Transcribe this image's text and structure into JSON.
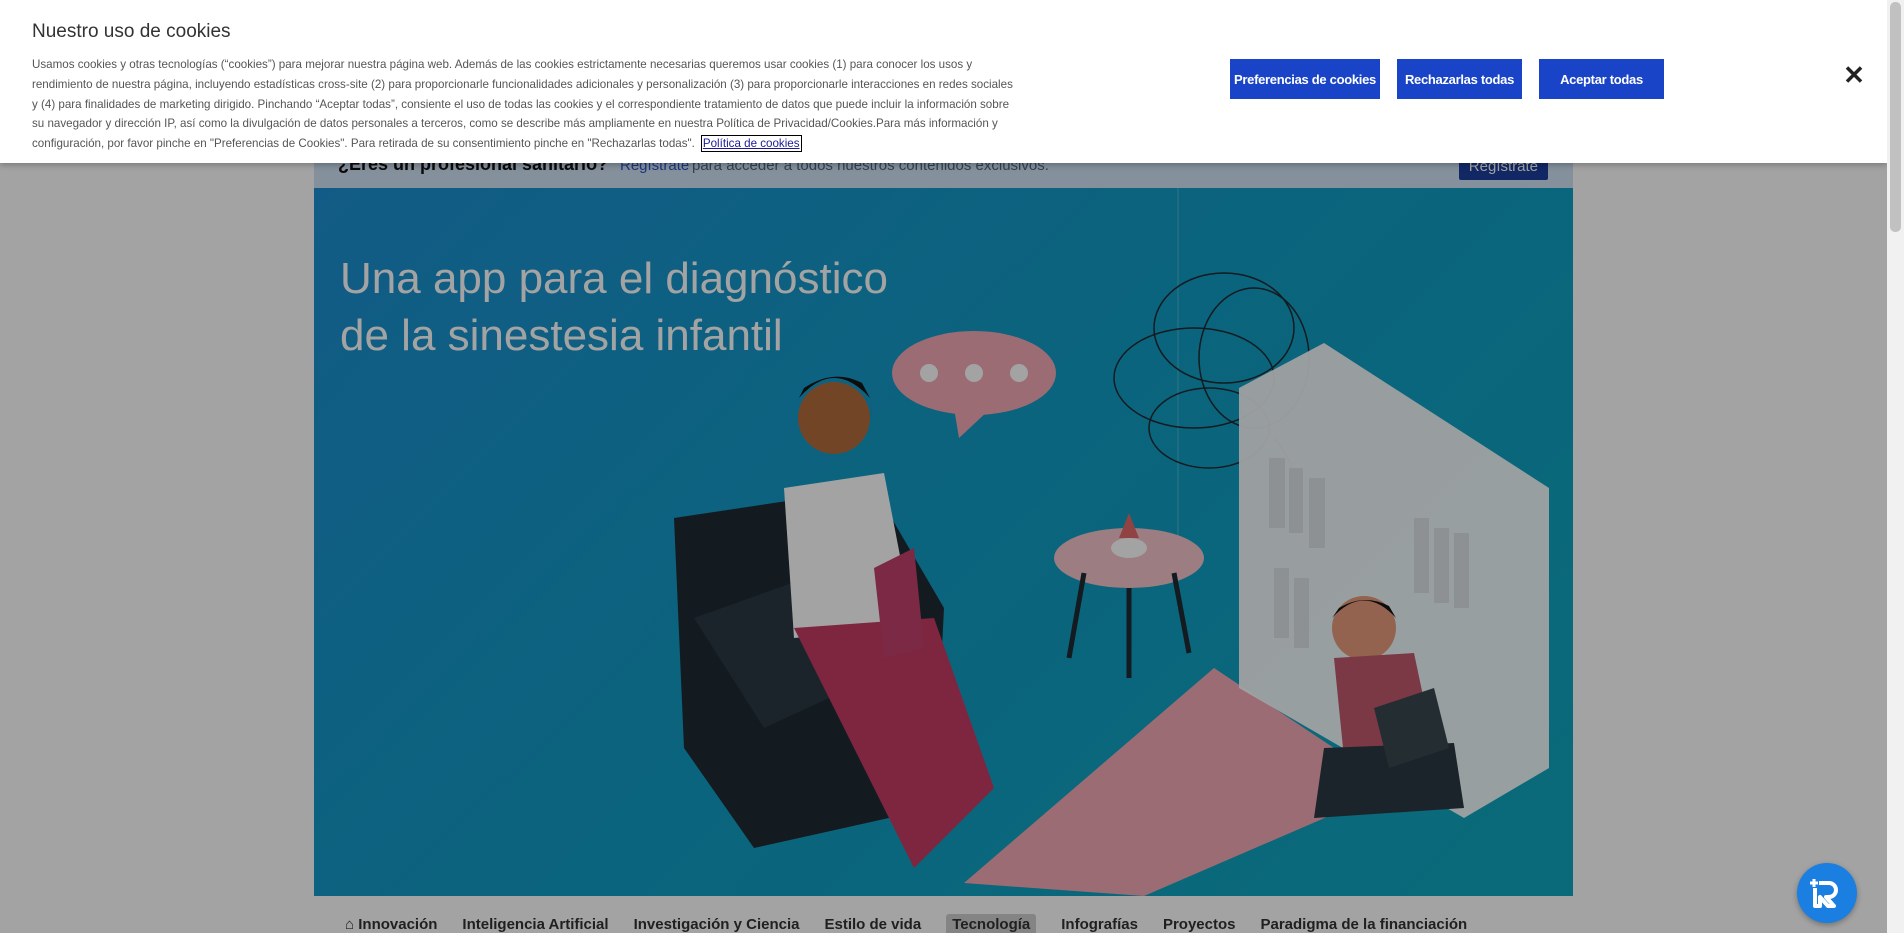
{
  "cookie_banner": {
    "title": "Nuestro uso de cookies",
    "body": "Usamos cookies y otras tecnologías (“cookies”) para mejorar nuestra página web. Además de las cookies estrictamente necesarias queremos usar cookies (1) para conocer los usos y rendimiento de nuestra página, incluyendo estadísticas cross-site (2) para proporcionarle funcionalidades adicionales y personalización (3) para proporcionarle interacciones en redes sociales y (4) para finalidades de marketing dirigido. Pinchando “Aceptar todas”, consiente el uso de todas las cookies y el correspondiente tratamiento de datos que puede incluir la información sobre su navegador y dirección IP, así como la divulgación de datos personales a terceros, como se describe más ampliamente en nuestra Política de Privacidad/Cookies.Para más información y configuración, por favor pinche en \"Preferencias de Cookies\". Para retirada de su consentimiento pinche en \"Rechazarlas todas\".",
    "policy_link": "Política de cookies",
    "preferences_button": "Preferencias de cookies",
    "reject_button": "Rechazarlas todas",
    "accept_button": "Aceptar todas",
    "close_icon": "close-icon"
  },
  "pro_banner": {
    "question": "¿Eres un profesional sanitario?",
    "link": "Regístrate",
    "rest": "para acceder a todos nuestros contenidos exclusivos.",
    "button": "Regístrate"
  },
  "hero": {
    "title_line1": "Una app para el diagnóstico",
    "title_line2": "de la sinestesia infantil"
  },
  "nav": {
    "items": [
      "Innovación",
      "Inteligencia Artificial",
      "Investigación y Ciencia",
      "Estilo de vida",
      "Tecnología",
      "Infografías",
      "Proyectos",
      "Paradigma de la financiación"
    ],
    "active": "Tecnología"
  },
  "colors": {
    "accent": "#1a44c7",
    "hero_bg": "#129cc5",
    "chat": "#1a7fe0"
  }
}
